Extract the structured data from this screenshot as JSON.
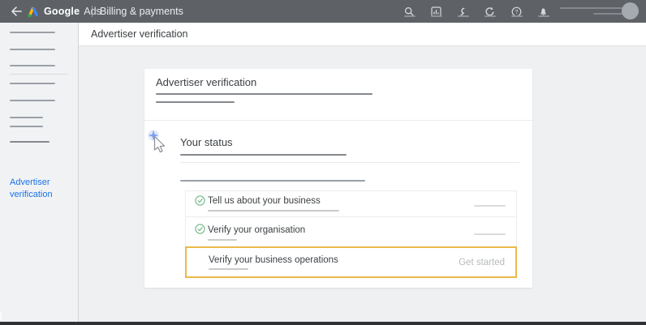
{
  "topbar": {
    "brand_google": "Google",
    "brand_ads": "Ads",
    "section_title": "Billing & payments",
    "back_icon": "arrow-left",
    "icons": [
      "search",
      "reports-chart",
      "tools-wrench",
      "refresh",
      "help",
      "notifications-bell"
    ]
  },
  "subheader": {
    "title": "Advertiser verification"
  },
  "sidebar": {
    "active_link": "Advertiser verification"
  },
  "card": {
    "title": "Advertiser verification",
    "status": {
      "title": "Your status",
      "items": [
        {
          "label": "Tell us about your business",
          "completed": true,
          "action": ""
        },
        {
          "label": "Verify your organisation",
          "completed": true,
          "action": ""
        },
        {
          "label": "Verify your business operations",
          "completed": false,
          "action": "Get started",
          "highlighted": true
        }
      ]
    }
  },
  "colors": {
    "topbar_bg": "#5e6267",
    "accent_blue": "#1a73e8",
    "check_green": "#7cbd8f",
    "highlight_yellow": "#eaba4b",
    "logo_blue": "#4285F4",
    "logo_yellow": "#FBBC04",
    "logo_green": "#34A853"
  }
}
